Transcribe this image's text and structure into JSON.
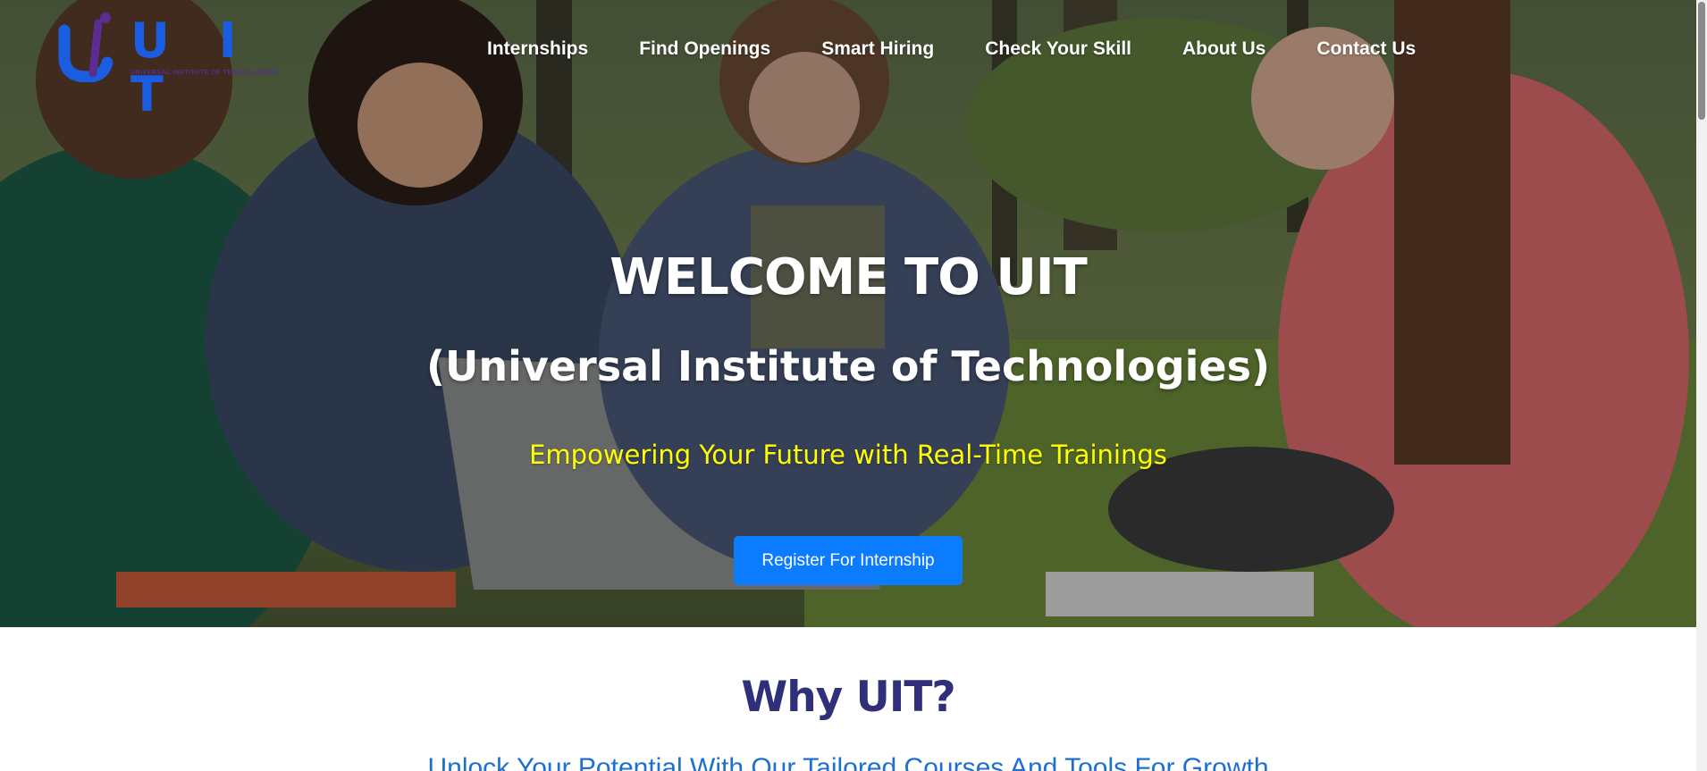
{
  "brand": {
    "logo_letters": "U I T",
    "logo_tagline": "UNIVERSAL INSTITUTE OF TECHNOLOGIES",
    "primary_color": "#1a5de0",
    "secondary_color": "#5b2d91"
  },
  "nav": {
    "items": [
      {
        "label": "Internships"
      },
      {
        "label": "Find Openings"
      },
      {
        "label": "Smart Hiring"
      },
      {
        "label": "Check Your Skill"
      },
      {
        "label": "About Us"
      },
      {
        "label": "Contact Us"
      }
    ]
  },
  "hero": {
    "title": "WELCOME TO UIT",
    "subtitle": "(Universal Institute of Technologies)",
    "tagline": "Empowering Your Future with Real-Time Trainings",
    "tagline_color": "#ffff00",
    "cta_label": "Register For Internship",
    "cta_color": "#0b7bff",
    "background_image": "students-with-laptop-in-park"
  },
  "why_section": {
    "title": "Why UIT?",
    "subtitle": "Unlock Your Potential With Our Tailored Courses And Tools For Growth"
  }
}
